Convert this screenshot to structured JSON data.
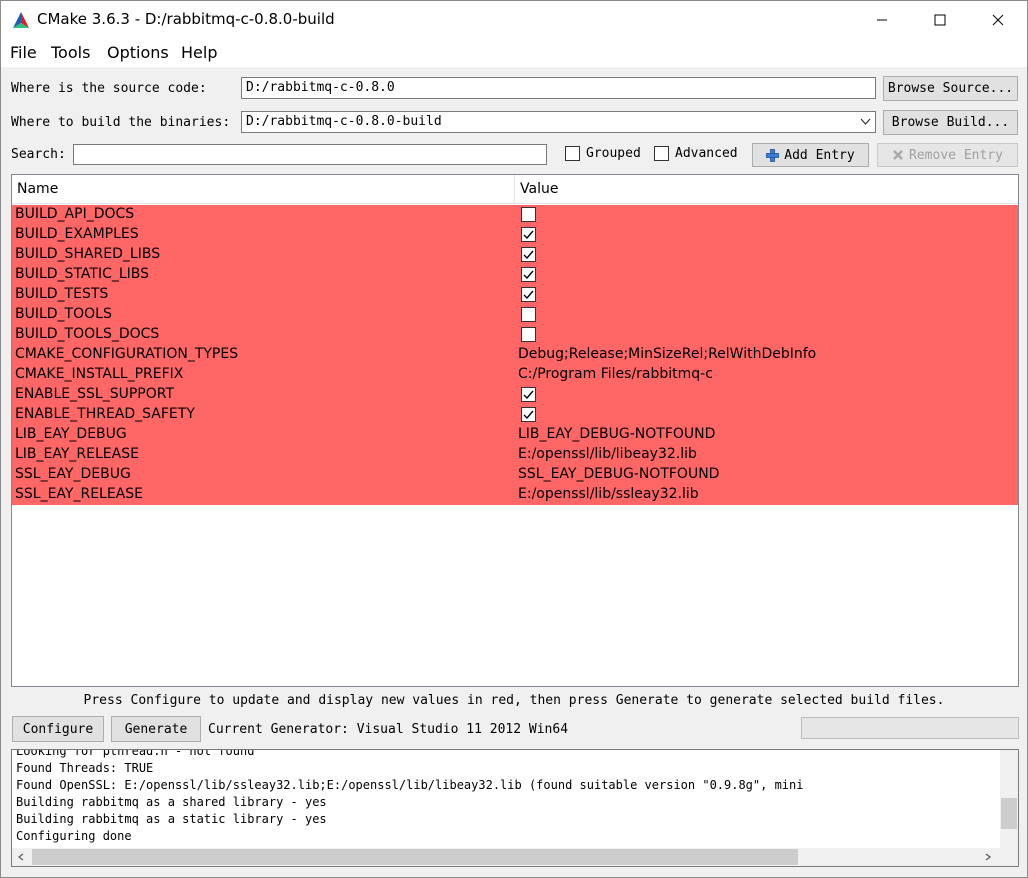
{
  "window": {
    "title": "CMake 3.6.3 - D:/rabbitmq-c-0.8.0-build"
  },
  "menu": [
    "File",
    "Tools",
    "Options",
    "Help"
  ],
  "source": {
    "label": "Where is the source code:",
    "value": "D:/rabbitmq-c-0.8.0",
    "browse_label": "Browse Source..."
  },
  "build": {
    "label": "Where to build the binaries:",
    "value": "D:/rabbitmq-c-0.8.0-build",
    "browse_label": "Browse Build..."
  },
  "search": {
    "label": "Search:",
    "value": ""
  },
  "options": {
    "grouped_label": "Grouped",
    "advanced_label": "Advanced",
    "add_entry_label": "Add Entry",
    "remove_entry_label": "Remove Entry"
  },
  "table": {
    "headers": {
      "name": "Name",
      "value": "Value"
    },
    "row_color": "#ff6666",
    "rows": [
      {
        "name": "BUILD_API_DOCS",
        "type": "bool",
        "checked": false
      },
      {
        "name": "BUILD_EXAMPLES",
        "type": "bool",
        "checked": true
      },
      {
        "name": "BUILD_SHARED_LIBS",
        "type": "bool",
        "checked": true
      },
      {
        "name": "BUILD_STATIC_LIBS",
        "type": "bool",
        "checked": true
      },
      {
        "name": "BUILD_TESTS",
        "type": "bool",
        "checked": true
      },
      {
        "name": "BUILD_TOOLS",
        "type": "bool",
        "checked": false
      },
      {
        "name": "BUILD_TOOLS_DOCS",
        "type": "bool",
        "checked": false
      },
      {
        "name": "CMAKE_CONFIGURATION_TYPES",
        "type": "string",
        "value": "Debug;Release;MinSizeRel;RelWithDebInfo"
      },
      {
        "name": "CMAKE_INSTALL_PREFIX",
        "type": "string",
        "value": "C:/Program Files/rabbitmq-c"
      },
      {
        "name": "ENABLE_SSL_SUPPORT",
        "type": "bool",
        "checked": true
      },
      {
        "name": "ENABLE_THREAD_SAFETY",
        "type": "bool",
        "checked": true
      },
      {
        "name": "LIB_EAY_DEBUG",
        "type": "string",
        "value": "LIB_EAY_DEBUG-NOTFOUND"
      },
      {
        "name": "LIB_EAY_RELEASE",
        "type": "string",
        "value": "E:/openssl/lib/libeay32.lib"
      },
      {
        "name": "SSL_EAY_DEBUG",
        "type": "string",
        "value": "SSL_EAY_DEBUG-NOTFOUND"
      },
      {
        "name": "SSL_EAY_RELEASE",
        "type": "string",
        "value": "E:/openssl/lib/ssleay32.lib"
      }
    ]
  },
  "hint": "Press Configure to update and display new values in red, then press Generate to generate selected build files.",
  "actions": {
    "configure_label": "Configure",
    "generate_label": "Generate",
    "generator_text": "Current Generator: Visual Studio 11 2012 Win64"
  },
  "output": {
    "lines": [
      "Looking for pthread.h - not found",
      "Found Threads: TRUE",
      "Found OpenSSL: E:/openssl/lib/ssleay32.lib;E:/openssl/lib/libeay32.lib (found suitable version \"0.9.8g\", mini",
      "Building rabbitmq as a shared library - yes",
      "Building rabbitmq as a static library - yes",
      "Configuring done"
    ]
  },
  "icons": {
    "app": "cmake-triangle-icon",
    "minimize": "minimize-icon",
    "maximize": "maximize-icon",
    "close": "close-icon",
    "add": "plus-icon",
    "remove": "x-icon",
    "dropdown": "chevron-down-icon",
    "check": "checkmark-icon"
  }
}
